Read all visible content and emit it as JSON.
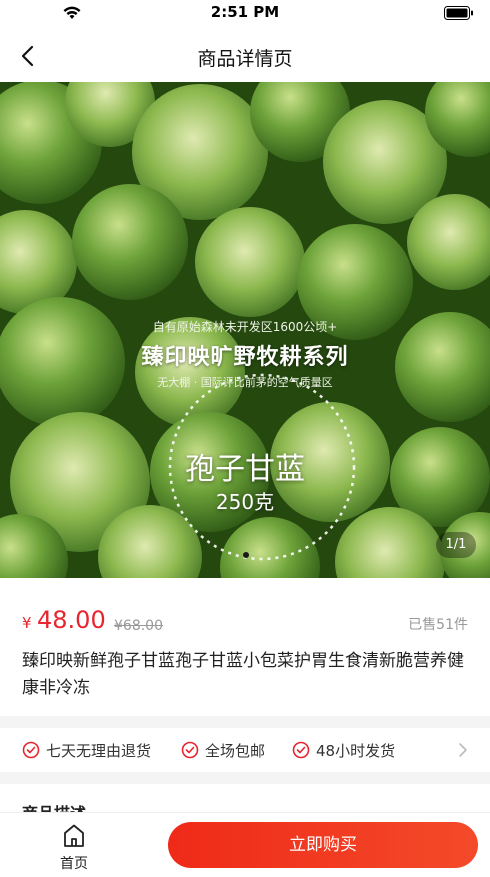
{
  "status_bar": {
    "time": "2:51 PM"
  },
  "nav": {
    "title": "商品详情页"
  },
  "banner": {
    "slogan_line1": "自有原始森林未开发区1600公顷+",
    "slogan_line2": "臻印映旷野牧耕系列",
    "slogan_line3": "无大棚 · 国际评比前茅的空气质量区",
    "product_title": "孢子甘蓝",
    "product_weight": "250克",
    "page_indicator": "1/1"
  },
  "product": {
    "currency": "¥",
    "price": "48.00",
    "original_price": "¥68.00",
    "sold": "已售51件",
    "name": "臻印映新鲜孢子甘蓝孢子甘蓝小包菜护胃生食清新脆营养健康非冷冻"
  },
  "services": [
    {
      "label": "七天无理由退货"
    },
    {
      "label": "全场包邮"
    },
    {
      "label": "48小时发货"
    }
  ],
  "description": {
    "title": "商品描述"
  },
  "bottom_bar": {
    "home_label": "首页",
    "buy_label": "立即购买"
  },
  "colors": {
    "accent": "#e8242f",
    "button": "#ef2a18"
  }
}
